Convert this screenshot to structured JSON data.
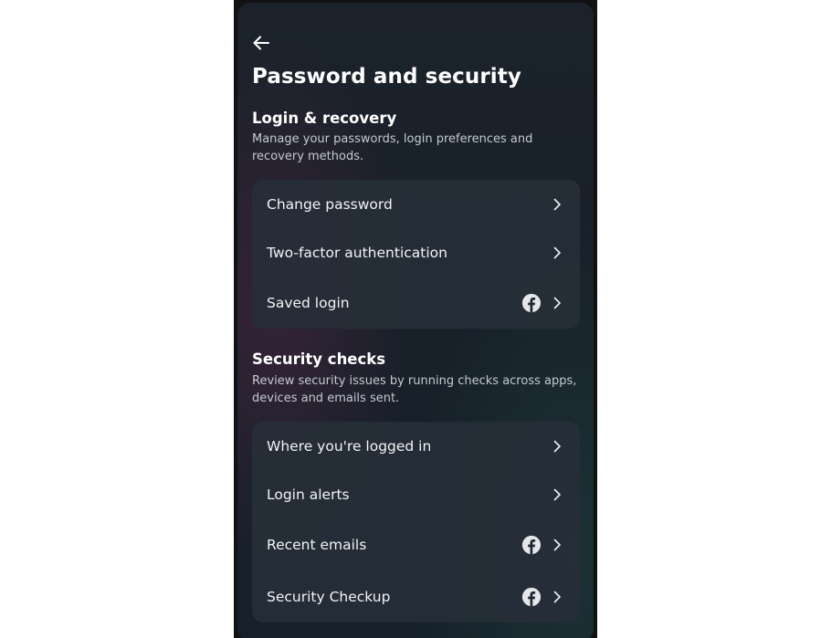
{
  "header": {
    "back_icon": "arrow-left-icon",
    "title": "Password and security"
  },
  "sections": [
    {
      "title": "Login & recovery",
      "description": "Manage your passwords, login preferences and recovery methods.",
      "items": [
        {
          "label": "Change password",
          "icon": "chevron-right-icon",
          "badge": ""
        },
        {
          "label": "Two-factor authentication",
          "icon": "chevron-right-icon",
          "badge": ""
        },
        {
          "label": "Saved login",
          "icon": "chevron-right-icon",
          "badge": "facebook-icon"
        }
      ]
    },
    {
      "title": "Security checks",
      "description": "Review security issues by running checks across apps, devices and emails sent.",
      "items": [
        {
          "label": "Where you're logged in",
          "icon": "chevron-right-icon",
          "badge": ""
        },
        {
          "label": "Login alerts",
          "icon": "chevron-right-icon",
          "badge": ""
        },
        {
          "label": "Recent emails",
          "icon": "chevron-right-icon",
          "badge": "facebook-icon"
        },
        {
          "label": "Security Checkup",
          "icon": "chevron-right-icon",
          "badge": "facebook-icon"
        }
      ]
    }
  ],
  "colors": {
    "background": "#182029",
    "card": "#262f38",
    "text_primary": "#ffffff",
    "text_secondary": "#c3cad3"
  }
}
